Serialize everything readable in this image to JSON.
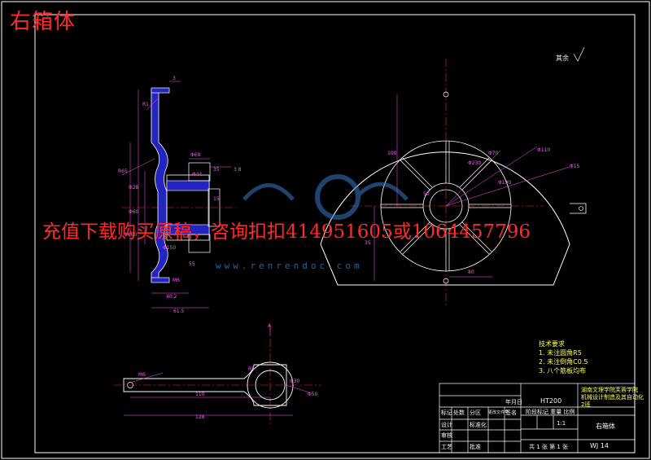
{
  "overlay_title": "右箱体",
  "watermark": "充值下载购买原稿，咨询扣扣414951605或1064457796",
  "watermark_site": "www.renrendoc.com",
  "roughness_note": "其余",
  "tech_requirements": {
    "heading": "技术要求",
    "items": [
      "1. 未注圆角R5",
      "2. 未注倒角C0.5",
      "3. 八个筋板均布"
    ]
  },
  "title_block": {
    "school": "湖南文理学院芙蓉学院",
    "project": "机械设计制造及其自动化",
    "project2": "2班",
    "part_name": "右箱体",
    "material": "HT200",
    "drawing_no": "WJ 14",
    "scale": "1:1",
    "sheet": "共 1 张 第 1 张",
    "labels": [
      "标记",
      "处数",
      "分区",
      "更改文件号",
      "签名",
      "年月日"
    ],
    "role_design": "设计",
    "role_check": "审核",
    "role_process": "工艺",
    "role_standard": "标准化",
    "role_approve": "批准",
    "stage_labels": "阶段标记 重量 比例"
  },
  "dimensions": {
    "side_view": [
      "3",
      "R1",
      "R65",
      "Φ69",
      "35",
      "Φ44",
      "Φ28",
      "Φ60",
      "Φ100",
      "Φ150",
      "M6",
      "61.5",
      "40.2",
      "3.8",
      "15",
      "55"
    ],
    "front_view": [
      "Φ110",
      "Φ70",
      "Φ15",
      "Φ230",
      "Φ190",
      "100",
      "35",
      "50",
      "80"
    ],
    "bottom_view": [
      "M6",
      "R5",
      "Φ30",
      "Φ50",
      "110",
      "128",
      "A"
    ]
  },
  "colors": {
    "background": "#000000",
    "outline": "#ffffff",
    "dimension": "#ff55ff",
    "centerline": "#ff2a2a",
    "hatch": "#4444ff",
    "text": "#ffff55",
    "watermark": "#ff2a2a"
  }
}
